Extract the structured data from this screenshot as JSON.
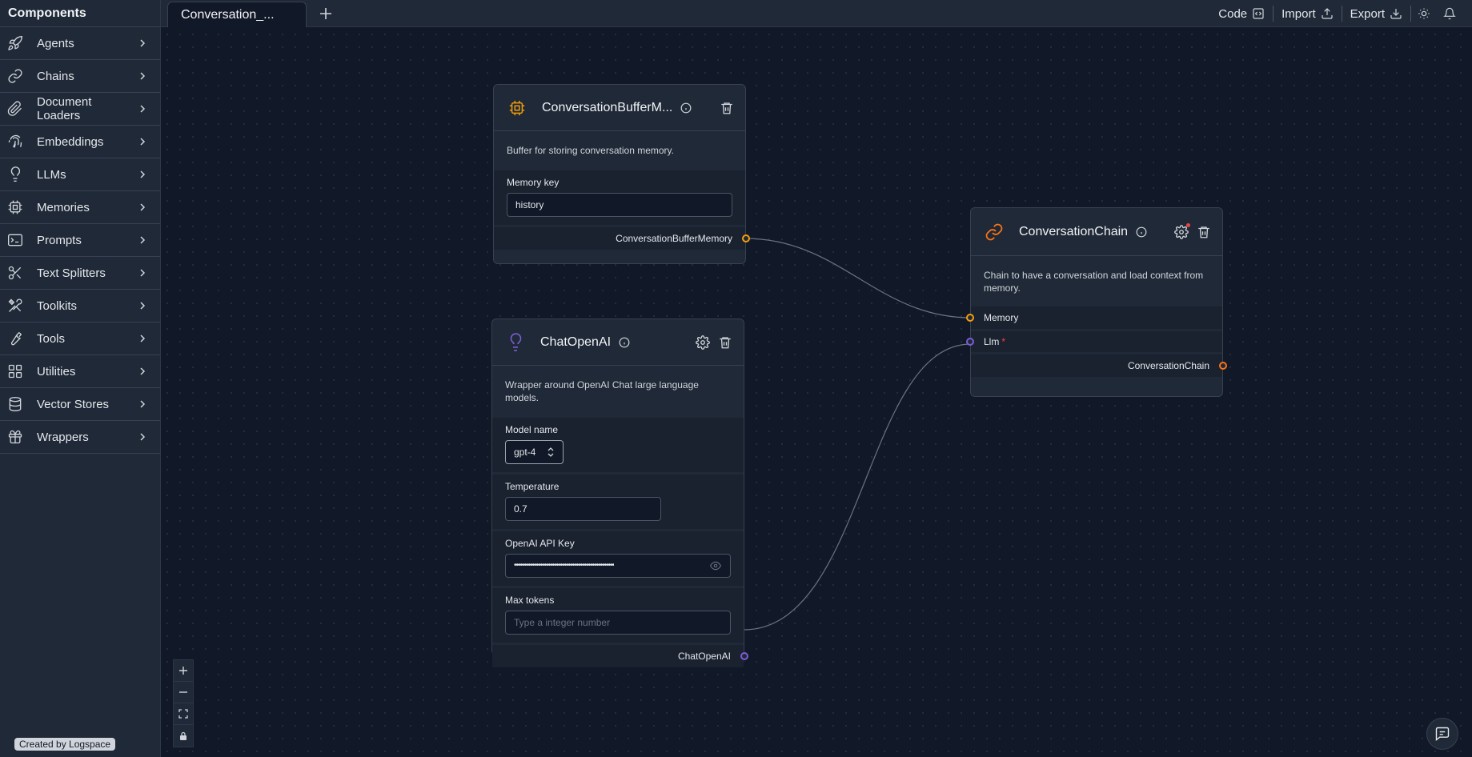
{
  "sidebar": {
    "title": "Components",
    "items": [
      {
        "label": "Agents",
        "icon": "rocket-icon"
      },
      {
        "label": "Chains",
        "icon": "link-icon"
      },
      {
        "label": "Document Loaders",
        "icon": "paperclip-icon"
      },
      {
        "label": "Embeddings",
        "icon": "fingerprint-icon"
      },
      {
        "label": "LLMs",
        "icon": "lightbulb-icon"
      },
      {
        "label": "Memories",
        "icon": "cpu-icon"
      },
      {
        "label": "Prompts",
        "icon": "terminal-icon"
      },
      {
        "label": "Text Splitters",
        "icon": "scissors-icon"
      },
      {
        "label": "Toolkits",
        "icon": "tools-icon"
      },
      {
        "label": "Tools",
        "icon": "wrench-icon"
      },
      {
        "label": "Utilities",
        "icon": "grid-icon"
      },
      {
        "label": "Vector Stores",
        "icon": "database-icon"
      },
      {
        "label": "Wrappers",
        "icon": "gift-icon"
      }
    ],
    "credit": "Created by Logspace"
  },
  "topbar": {
    "tab_label": "Conversation_...",
    "code_label": "Code",
    "import_label": "Import",
    "export_label": "Export"
  },
  "nodes": {
    "memory": {
      "title": "ConversationBufferM...",
      "description": "Buffer for storing conversation memory.",
      "field_label": "Memory key",
      "field_value": "history",
      "output_label": "ConversationBufferMemory",
      "accent": "#f59e0b"
    },
    "chat": {
      "title": "ChatOpenAI",
      "description": "Wrapper around OpenAI Chat large language models.",
      "model_label": "Model name",
      "model_value": "gpt-4",
      "temperature_label": "Temperature",
      "temperature_value": "0.7",
      "api_key_label": "OpenAI API Key",
      "api_key_value": "••••••••••••••••••••••••••••••••••••••••••••••••••",
      "max_tokens_label": "Max tokens",
      "max_tokens_placeholder": "Type a integer number",
      "output_label": "ChatOpenAI",
      "accent": "#7c5cd6"
    },
    "chain": {
      "title": "ConversationChain",
      "description": "Chain to have a conversation and load context from memory.",
      "input_memory_label": "Memory",
      "input_llm_label": "Llm",
      "required_mark": "*",
      "output_label": "ConversationChain",
      "accent": "#f97316"
    }
  },
  "colors": {
    "background": "#111827",
    "panel": "#1f2937",
    "edge": "#6b7280"
  }
}
